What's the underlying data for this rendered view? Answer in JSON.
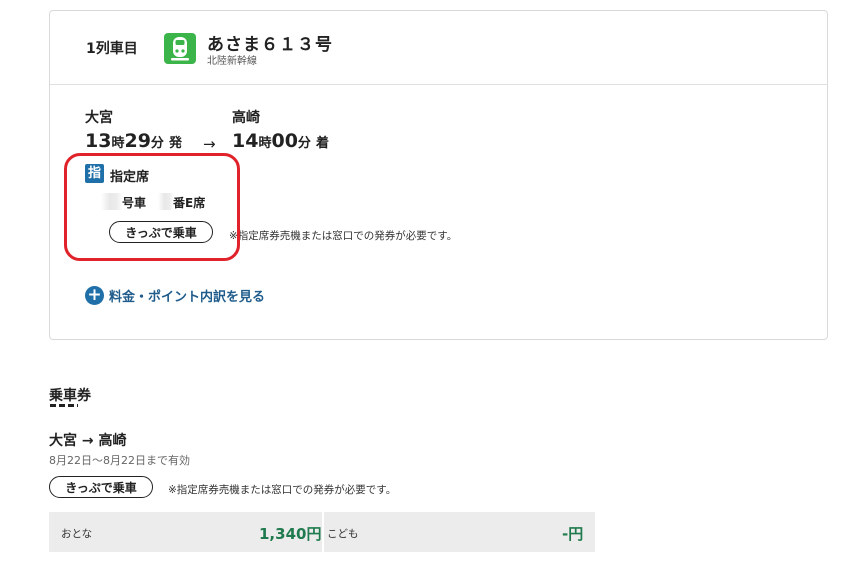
{
  "itinerary": {
    "row_label": "1列車目",
    "train_name": "あさま６１３号",
    "train_line": "北陸新幹線",
    "departure": {
      "station": "大宮",
      "hour": "13",
      "hour_unit": "時",
      "minute": "29",
      "minute_unit": "分",
      "label": "発"
    },
    "arrival": {
      "station": "高崎",
      "hour": "14",
      "hour_unit": "時",
      "minute": "00",
      "minute_unit": "分",
      "label": "着"
    },
    "arrow": "→",
    "seat": {
      "badge": "指",
      "type": "指定席",
      "car_unit": "号車",
      "seat_unit": "番E席",
      "ticket_button": "きっぷで乗車",
      "note": "※指定席券売機または窓口での発券が必要です。"
    },
    "detail_link": "料金・ポイント内訳を見る",
    "detail_icon": "+",
    "highlight_color": "#e0222a"
  },
  "fare_ticket": {
    "section_title": "乗車券",
    "route": "大宮 → 高崎",
    "validity": "8月22日〜8月22日まで有効",
    "ticket_button": "きっぷで乗車",
    "note": "※指定席券売機または窓口での発券が必要です。",
    "adult_label": "おとな",
    "adult_price": "1,340円",
    "child_label": "こども",
    "child_price": "-円"
  },
  "colors": {
    "train_icon": "#3bb44a",
    "accent_blue": "#1f6fa8",
    "price_green": "#1f7a4d"
  },
  "icons": [
    "train-icon",
    "plus-circle-icon"
  ]
}
